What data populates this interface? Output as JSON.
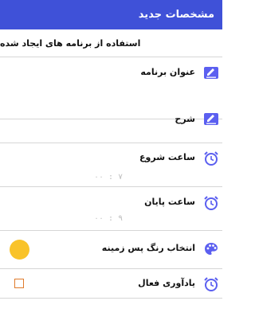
{
  "appbar": {
    "title": "مشخصات جدید"
  },
  "subtitle": "استفاده از برنامه های ایجاد شده",
  "fields": {
    "title_label": "عنوان برنامه",
    "description_label": "شرح",
    "start_label": "ساعت شروع",
    "start_hint": "۰۰ : ۷",
    "end_label": "ساعت پایان",
    "end_hint": "۰۰ : ۹",
    "color_label": "انتخاب رنگ پس زمینه",
    "reminder_label": "یادآوری فعال"
  },
  "colors": {
    "primary": "#3f51d8",
    "accent_icon": "#5b5ff0",
    "selected_background": "#f9c32a",
    "checkbox_border": "#e07b2c"
  },
  "icons": {
    "title": "pencil-icon",
    "description": "pencil-icon",
    "start": "alarm-clock-icon",
    "end": "alarm-clock-icon",
    "color": "palette-icon",
    "reminder": "alarm-clock-icon"
  },
  "reminder_enabled": false
}
